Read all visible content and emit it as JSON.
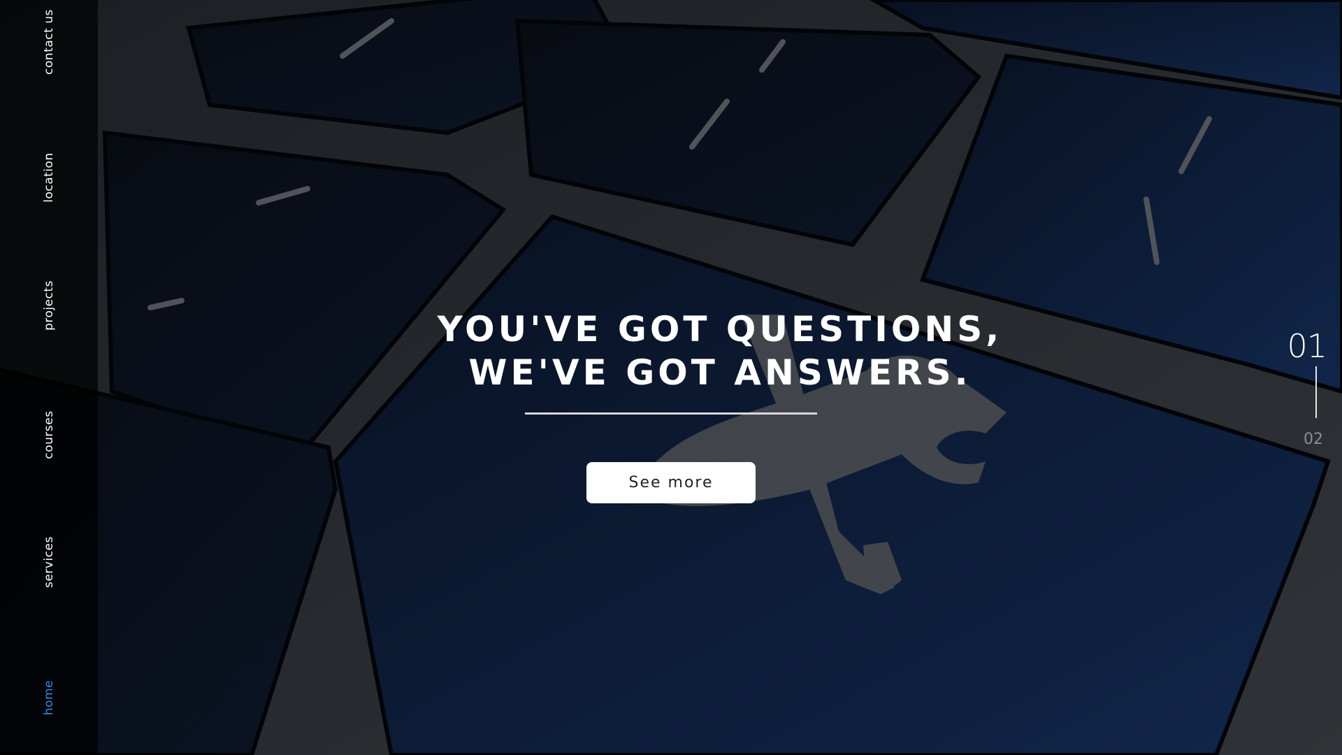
{
  "sidebar": {
    "items": [
      {
        "label": "contact us",
        "active": false
      },
      {
        "label": "location",
        "active": false
      },
      {
        "label": "projects",
        "active": false
      },
      {
        "label": "courses",
        "active": false
      },
      {
        "label": "services",
        "active": false
      },
      {
        "label": "home",
        "active": true
      }
    ],
    "active_color": "#2e8be8"
  },
  "hero": {
    "headline_line1": "YOU'VE GOT QUESTIONS,",
    "headline_line2": "WE'VE GOT ANSWERS.",
    "cta_label": "See more",
    "background_icon": "tools-icon"
  },
  "pager": {
    "current": "01",
    "next": "02"
  }
}
